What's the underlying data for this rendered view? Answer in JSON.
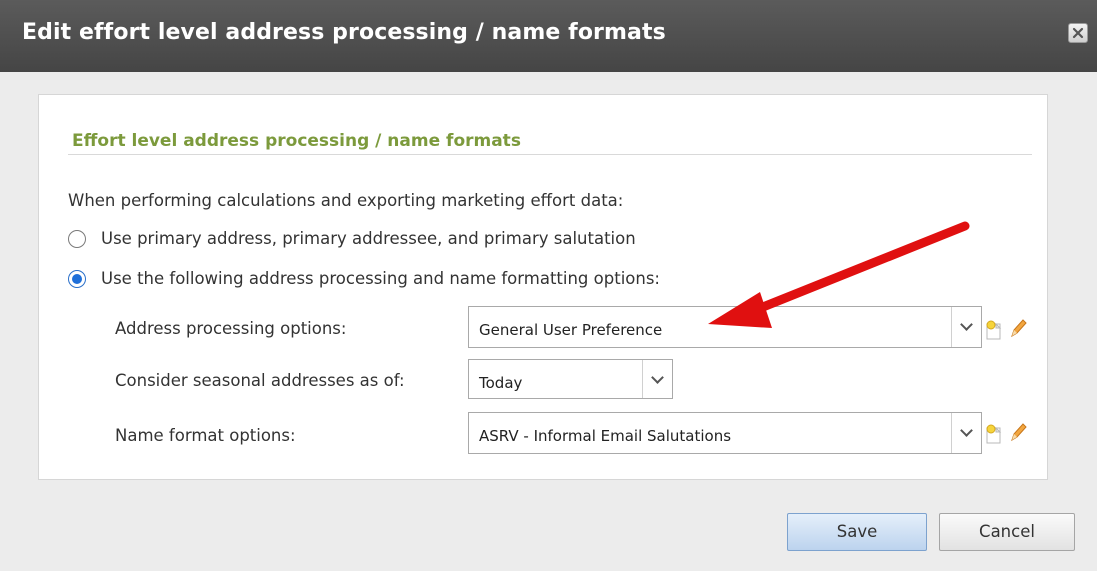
{
  "dialog": {
    "title": "Edit effort level address processing / name formats",
    "close_icon": "close-icon"
  },
  "section": {
    "title": "Effort level address processing / name formats",
    "intro": "When performing calculations and exporting marketing effort data:"
  },
  "options": [
    {
      "label": "Use primary address, primary addressee, and primary salutation",
      "checked": false
    },
    {
      "label": "Use the following address processing and name formatting options:",
      "checked": true
    }
  ],
  "fields": {
    "address_processing": {
      "label": "Address processing options:",
      "value": "General User Preference"
    },
    "seasonal": {
      "label": "Consider seasonal addresses as of:",
      "value": "Today"
    },
    "name_format": {
      "label": "Name format options:",
      "value": "ASRV - Informal Email Salutations"
    }
  },
  "buttons": {
    "save": "Save",
    "cancel": "Cancel"
  },
  "colors": {
    "titlebar": "#4f4f4f",
    "section_title": "#7c9a3c",
    "radio_selected": "#1e6fd9",
    "annotation_arrow": "#e01010"
  }
}
